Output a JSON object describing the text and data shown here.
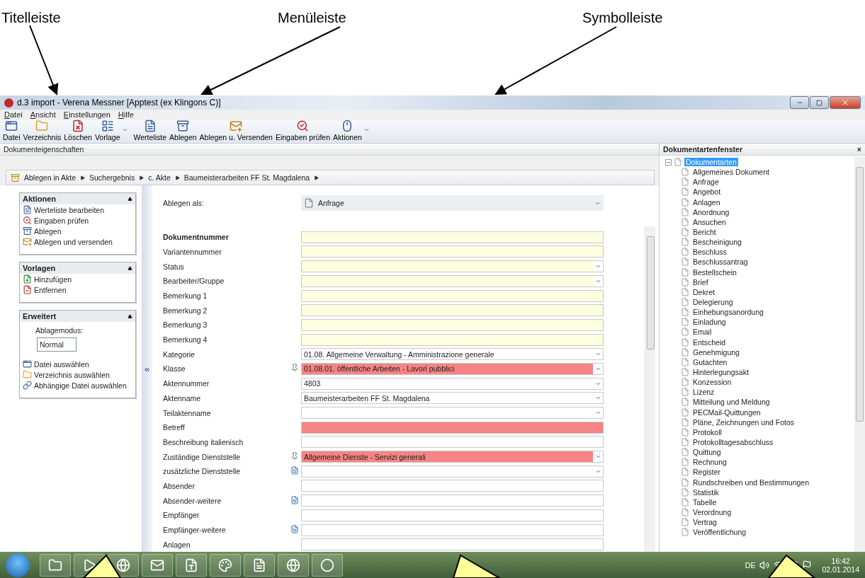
{
  "annotations": {
    "labels": [
      "Titelleiste",
      "Menüleiste",
      "Symbolleiste"
    ]
  },
  "window": {
    "title": "d.3 import - Verena Messner [Apptest (ex Klingons C)]"
  },
  "menu": [
    "Datei",
    "Ansicht",
    "Einstellungen",
    "Hilfe"
  ],
  "toolbar": [
    {
      "label": "Datei",
      "dropdown": false
    },
    {
      "label": "Verzeichnis",
      "dropdown": false
    },
    {
      "label": "Löschen",
      "dropdown": false
    },
    {
      "label": "Vorlage",
      "dropdown": true
    },
    {
      "label": "Werteliste",
      "dropdown": false
    },
    {
      "label": "Ablegen",
      "dropdown": false
    },
    {
      "label": "Ablegen u. Versenden",
      "dropdown": false
    },
    {
      "label": "Eingaben prüfen",
      "dropdown": false
    },
    {
      "label": "Aktionen",
      "dropdown": true
    }
  ],
  "properties_pane": {
    "title": "Dokumenteigenschaften",
    "breadcrumb": [
      "Ablegen in Akte",
      "Suchergebnis",
      "c. Akte",
      "Baumeisterarbeiten FF St. Magdalena"
    ],
    "sections": [
      {
        "title": "Aktionen",
        "expanded": true,
        "items": [
          "Werteliste bearbeiten",
          "Eingaben prüfen",
          "Ablegen",
          "Ablegen und versenden"
        ]
      },
      {
        "title": "Vorlagen",
        "expanded": true,
        "items": [
          "Hinzufügen",
          "Entfernen"
        ]
      },
      {
        "title": "Erweitert",
        "expanded": true,
        "mode_label": "Ablagemodus:",
        "mode_value": "Normal",
        "items": [
          "Datei auswählen",
          "Verzeichnis auswählen",
          "Abhängige Datei auswählen"
        ]
      }
    ],
    "collapse": "«",
    "file_as": {
      "label": "Ablegen als:",
      "value": "Anfrage"
    },
    "fields": [
      {
        "label": "Dokumentnummer",
        "bold": true,
        "kind": "text",
        "required": true,
        "invalid": false
      },
      {
        "label": "Variantennummer",
        "bold": false,
        "kind": "text",
        "required": true,
        "invalid": false
      },
      {
        "label": "Status",
        "bold": false,
        "kind": "combo",
        "required": true,
        "invalid": false
      },
      {
        "label": "Bearbeiter/Gruppe",
        "bold": false,
        "kind": "combo",
        "required": true,
        "invalid": false
      },
      {
        "label": "Bemerkung 1",
        "bold": false,
        "kind": "text",
        "required": true,
        "invalid": false
      },
      {
        "label": "Bemerkung 2",
        "bold": false,
        "kind": "text",
        "required": true,
        "invalid": false
      },
      {
        "label": "Bemerkung 3",
        "bold": false,
        "kind": "text",
        "required": true,
        "invalid": false
      },
      {
        "label": "Bemerkung 4",
        "bold": false,
        "kind": "text",
        "required": true,
        "invalid": false
      },
      {
        "label": "Kategorie",
        "bold": false,
        "kind": "combo",
        "required": false,
        "invalid": false,
        "value": "01.08. Allgemeine Verwaltung - Amministrazione generale"
      },
      {
        "label": "Klasse",
        "bold": false,
        "kind": "combo",
        "required": false,
        "invalid": true,
        "pinned": true,
        "value": "01.08.01. öffentliche Arbeiten - Lavori pubblici"
      },
      {
        "label": "Aktennummer",
        "bold": false,
        "kind": "combo",
        "required": false,
        "invalid": false,
        "value": "4803"
      },
      {
        "label": "Aktenname",
        "bold": false,
        "kind": "combo",
        "required": false,
        "invalid": false,
        "value": "Baumeisterarbeiten FF St. Magdalena"
      },
      {
        "label": "Teilaktenname",
        "bold": false,
        "kind": "combo",
        "required": false,
        "invalid": false
      },
      {
        "label": "Betreff",
        "bold": false,
        "kind": "text",
        "required": false,
        "invalid": true
      },
      {
        "label": "Beschreibung italienisch",
        "bold": false,
        "kind": "text",
        "required": false,
        "invalid": false
      },
      {
        "label": "Zuständige Dienststelle",
        "bold": false,
        "kind": "combo",
        "required": false,
        "invalid": true,
        "pinned": true,
        "value": "Allgemeine Dienste - Servizi generali"
      },
      {
        "label": "zusätzliche Dienststelle",
        "bold": false,
        "kind": "combo",
        "required": false,
        "invalid": false,
        "multi": true
      },
      {
        "label": "Absender",
        "bold": false,
        "kind": "text",
        "required": false,
        "invalid": false
      },
      {
        "label": "Absender-weitere",
        "bold": false,
        "kind": "text",
        "required": false,
        "invalid": false,
        "multi": true
      },
      {
        "label": "Empfänger",
        "bold": false,
        "kind": "text",
        "required": false,
        "invalid": false
      },
      {
        "label": "Empfänger-weitere",
        "bold": false,
        "kind": "text",
        "required": false,
        "invalid": false,
        "multi": true
      },
      {
        "label": "Anlagen",
        "bold": false,
        "kind": "text",
        "required": false,
        "invalid": false
      }
    ]
  },
  "doctypes_pane": {
    "title": "Dokumentartenfenster",
    "close": "×",
    "tree": {
      "label": "Dokumentarten",
      "expanded": true,
      "selected": true,
      "children": [
        {
          "label": "Allgemeines Dokument",
          "selected": false
        },
        {
          "label": "Anfrage",
          "selected": false
        },
        {
          "label": "Angebot",
          "selected": false
        },
        {
          "label": "Anlagen",
          "selected": false
        },
        {
          "label": "Anordnung",
          "selected": false
        },
        {
          "label": "Ansuchen",
          "selected": false
        },
        {
          "label": "Bericht",
          "selected": false
        },
        {
          "label": "Bescheinigung",
          "selected": false
        },
        {
          "label": "Beschluss",
          "selected": false
        },
        {
          "label": "Beschlussantrag",
          "selected": false
        },
        {
          "label": "Bestellschein",
          "selected": false
        },
        {
          "label": "Brief",
          "selected": false
        },
        {
          "label": "Dekret",
          "selected": false
        },
        {
          "label": "Delegierung",
          "selected": false
        },
        {
          "label": "Einhebungsanordung",
          "selected": false
        },
        {
          "label": "Einladung",
          "selected": false
        },
        {
          "label": "Email",
          "selected": false
        },
        {
          "label": "Entscheid",
          "selected": false
        },
        {
          "label": "Genehmigung",
          "selected": false
        },
        {
          "label": "Gutachten",
          "selected": false
        },
        {
          "label": "Hinterlegungsakt",
          "selected": false
        },
        {
          "label": "Konzession",
          "selected": false
        },
        {
          "label": "Lizenz",
          "selected": false
        },
        {
          "label": "Mitteilung und Meldung",
          "selected": false
        },
        {
          "label": "PECMail-Quittungen",
          "selected": false
        },
        {
          "label": "Pläne, Zeichnungen und Fotos",
          "selected": false
        },
        {
          "label": "Protokoll",
          "selected": false
        },
        {
          "label": "Protokolltagesabschluss",
          "selected": false
        },
        {
          "label": "Quittung",
          "selected": false
        },
        {
          "label": "Rechnung",
          "selected": false
        },
        {
          "label": "Register",
          "selected": false
        },
        {
          "label": "Rundschreiben und Bestimmungen",
          "selected": false
        },
        {
          "label": "Statistik",
          "selected": false
        },
        {
          "label": "Tabelle",
          "selected": false
        },
        {
          "label": "Verordnung",
          "selected": false
        },
        {
          "label": "Vertrag",
          "selected": false
        },
        {
          "label": "Veröffentlichung",
          "selected": false
        }
      ]
    }
  },
  "taskbar": {
    "language": "DE",
    "time": "16:42",
    "date": "02.01.2014"
  }
}
